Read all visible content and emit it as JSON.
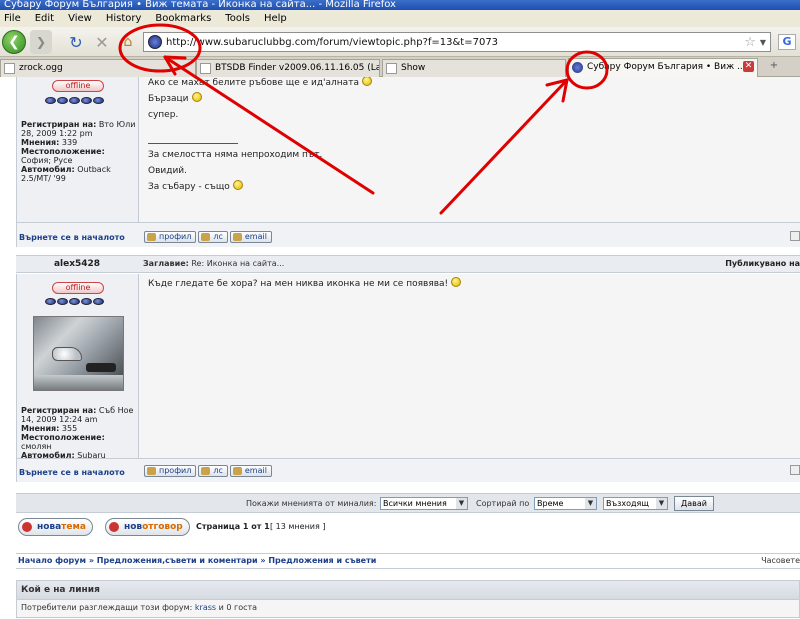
{
  "window": {
    "title": "Субару Форум България • Виж темата - Иконка на сайта... - Mozilla Firefox"
  },
  "menu": [
    "File",
    "Edit",
    "View",
    "History",
    "Bookmarks",
    "Tools",
    "Help"
  ],
  "toolbar": {
    "url": "http://www.subaruclubbg.com/forum/viewtopic.php?f=13&t=7073",
    "search_engine": "G"
  },
  "tabs": [
    {
      "label": "zrock.ogg"
    },
    {
      "label": "BTSDB Finder v2009.06.11.16.05 (Last..."
    },
    {
      "label": "Show"
    },
    {
      "label": "Субару Форум България • Виж ..."
    }
  ],
  "post1": {
    "status": "offline",
    "profile_lines": [
      [
        "Регистриран на:",
        " Вто Юли 28, 2009 1:22 pm"
      ],
      [
        "Мнения:",
        " 339"
      ],
      [
        "Местоположение:",
        " София; Русе"
      ],
      [
        "Автомобил:",
        " Outback 2.5/MT/ '99"
      ]
    ],
    "message_lines": [
      "Ако се махат белите ръбове ще е ид'алната",
      "Бързаци",
      "супер."
    ],
    "signature_lines": [
      "За смелостта няма непроходим път.",
      "Овидий.",
      "За събару - също"
    ],
    "back_to_top": "Върнете се в началото",
    "buttons": [
      "профил",
      "лс",
      "email"
    ]
  },
  "post2": {
    "author": "alex5428",
    "subject_label": "Заглавие:",
    "subject": "Re: Иконка на сайта...",
    "posted": "Публикувано на",
    "status": "offline",
    "profile_lines": [
      [
        "Регистриран на:",
        " Съб Ное 14, 2009 12:24 am"
      ],
      [
        "Мнения:",
        " 355"
      ],
      [
        "Местоположение:",
        " смолян"
      ],
      [
        "Автомобил:",
        " Subaru Impreza WRX"
      ]
    ],
    "message": "Къде гледате бе хора? на мен никва иконка не ми се появява!",
    "back_to_top": "Върнете се в началото",
    "buttons": [
      "профил",
      "лс",
      "email"
    ]
  },
  "sort": {
    "show_label": "Покажи мненията от миналия:",
    "show_value": "Всички мнения",
    "sort_label": "Сортирай по",
    "sort_value": "Време",
    "order_value": "Възходящ",
    "go": "Давай"
  },
  "actions": {
    "new_topic_a": "нова",
    "new_topic_b": "тема",
    "reply_a": "нов",
    "reply_b": "отговор",
    "page_info": "Страница 1 от 1",
    "post_count": "[ 13 мнения ]"
  },
  "breadcrumb": {
    "items": [
      "Начало форум",
      "Предложения,съвети и коментари",
      "Предложения и съвети"
    ],
    "timezone": "Часовете"
  },
  "whois": {
    "title": "Кой е на линия",
    "text_prefix": "Потребители разглеждащи този форум:",
    "user": "krass",
    "text_suffix": "и 0 госта"
  }
}
